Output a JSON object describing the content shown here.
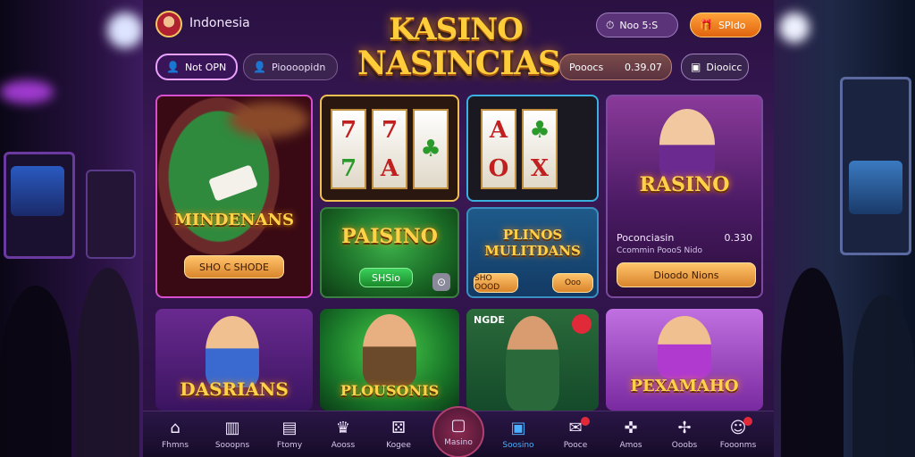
{
  "header": {
    "region": "Indonesia",
    "logo_line1": "KASINO",
    "logo_line2": "NASINCIAS",
    "login_label": "Not OPN",
    "register_label": "Pioooopidn",
    "help_label": "Noo 5:S",
    "promo_label": "SPIdo",
    "balance_label": "Pooocs",
    "balance_value": "0.39.07",
    "deposit_label": "Diooicc"
  },
  "games": [
    {
      "title": "MINDENANS",
      "button": "SHO C SHODE"
    },
    {
      "title": "PAISINO",
      "subtitle": "",
      "button": "SHSio"
    },
    {
      "title": "PLINOS\nMULITDANS",
      "button_left": "SHO OOOD",
      "button_right": "Ooo"
    },
    {
      "title": "RASINO",
      "subtitle": "Poconciasin",
      "value": "0.330",
      "detail": "Ccommin PoooS Nido",
      "button": "Dioodo Nions"
    },
    {
      "title": "DASRIANS"
    },
    {
      "title": "PLOUSONIS"
    },
    {
      "title": "NGDE",
      "subtitle": ""
    },
    {
      "title": "PEXAMAHO"
    }
  ],
  "reels": {
    "slot_a": [
      "7",
      "7",
      "7",
      "A"
    ],
    "slot_b": [
      "A",
      "O",
      "X"
    ]
  },
  "bottom_nav": [
    {
      "label": "Fhmns",
      "icon": "home-icon"
    },
    {
      "label": "Sooopns",
      "icon": "cards-icon"
    },
    {
      "label": "Ftomy",
      "icon": "card-icon"
    },
    {
      "label": "Aooss",
      "icon": "trophy-icon"
    },
    {
      "label": "Kogee",
      "icon": "dice-icon"
    },
    {
      "label": "Masino",
      "icon": "casino-icon",
      "active": true
    },
    {
      "label": "Soosino",
      "icon": "live-icon"
    },
    {
      "label": "Pooce",
      "icon": "ticket-icon"
    },
    {
      "label": "Amos",
      "icon": "controller-icon"
    },
    {
      "label": "Ooobs",
      "icon": "bonus-icon"
    },
    {
      "label": "Fooonms",
      "icon": "profile-icon"
    }
  ]
}
